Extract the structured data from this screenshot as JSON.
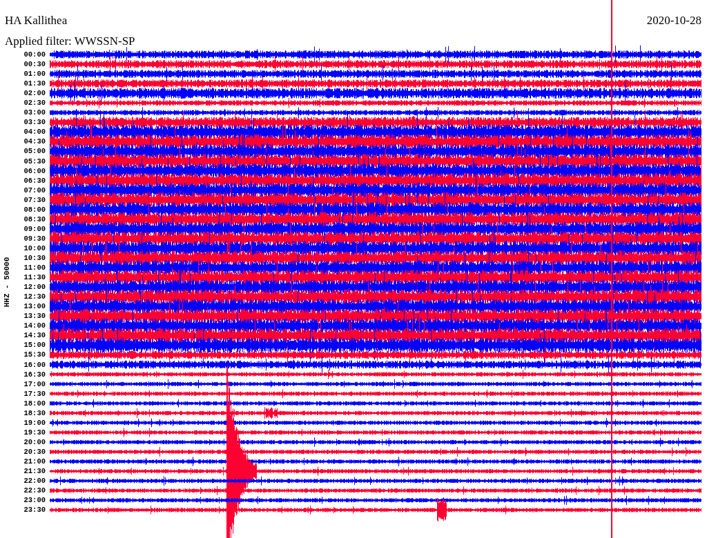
{
  "station": "HA Kallithea",
  "date": "2020-10-28",
  "filter": "Applied filter: WWSSN-SP",
  "channel": "HHZ - 50000",
  "rows": [
    "00:00",
    "00:30",
    "01:00",
    "01:30",
    "02:00",
    "02:30",
    "03:00",
    "03:30",
    "04:00",
    "04:30",
    "05:00",
    "05:30",
    "06:00",
    "06:30",
    "07:00",
    "07:30",
    "08:00",
    "08:30",
    "09:00",
    "09:30",
    "10:00",
    "10:30",
    "11:00",
    "11:30",
    "12:00",
    "12:30",
    "13:00",
    "13:30",
    "14:00",
    "14:30",
    "15:00",
    "15:30",
    "16:00",
    "16:30",
    "17:00",
    "17:30",
    "18:00",
    "18:30",
    "19:00",
    "19:30",
    "20:00",
    "20:30",
    "21:00",
    "21:30",
    "22:00",
    "22:30",
    "23:00",
    "23:30"
  ]
}
